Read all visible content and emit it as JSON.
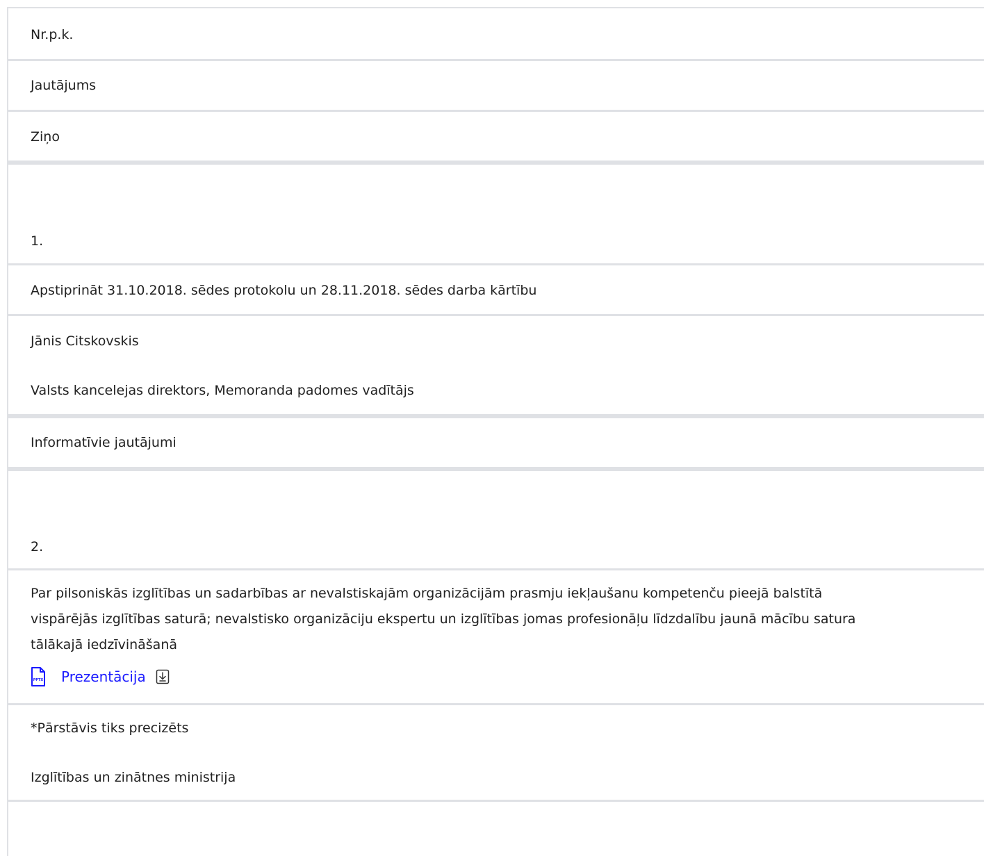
{
  "header": {
    "nr_label": "Nr.p.k.",
    "question_label": "Jautājums",
    "reporter_label": "Ziņo"
  },
  "items": [
    {
      "number": "1.",
      "question": "Apstiprināt 31.10.2018. sēdes protokolu un 28.11.2018. sēdes darba kārtību",
      "reporter_name": "Jānis Citskovskis",
      "reporter_role": "Valsts kancelejas direktors, Memoranda padomes vadītājs"
    },
    {
      "number": "2.",
      "question_line1": "Par pilsoniskās izglītības un sadarbības ar nevalstiskajām organizācijām prasmju iekļaušanu kompetenču pieejā balstītā",
      "question_line2": "vispārējās izglītības saturā; nevalstisko organizāciju ekspertu un izglītības jomas profesionāļu līdzdalību jaunā mācību satura",
      "question_line3": "tālākajā iedzīvināšanā",
      "attachment_label": "Prezentācija",
      "attachment_type": "PPTX",
      "reporter_name": "*Pārstāvis tiks precizēts",
      "reporter_role": "Izglītības un zinātnes ministrija"
    }
  ],
  "section_informative": "Informatīvie jautājumi",
  "colors": {
    "link": "#1a1aff",
    "divider": "#dfe1e5",
    "text": "#222222"
  }
}
